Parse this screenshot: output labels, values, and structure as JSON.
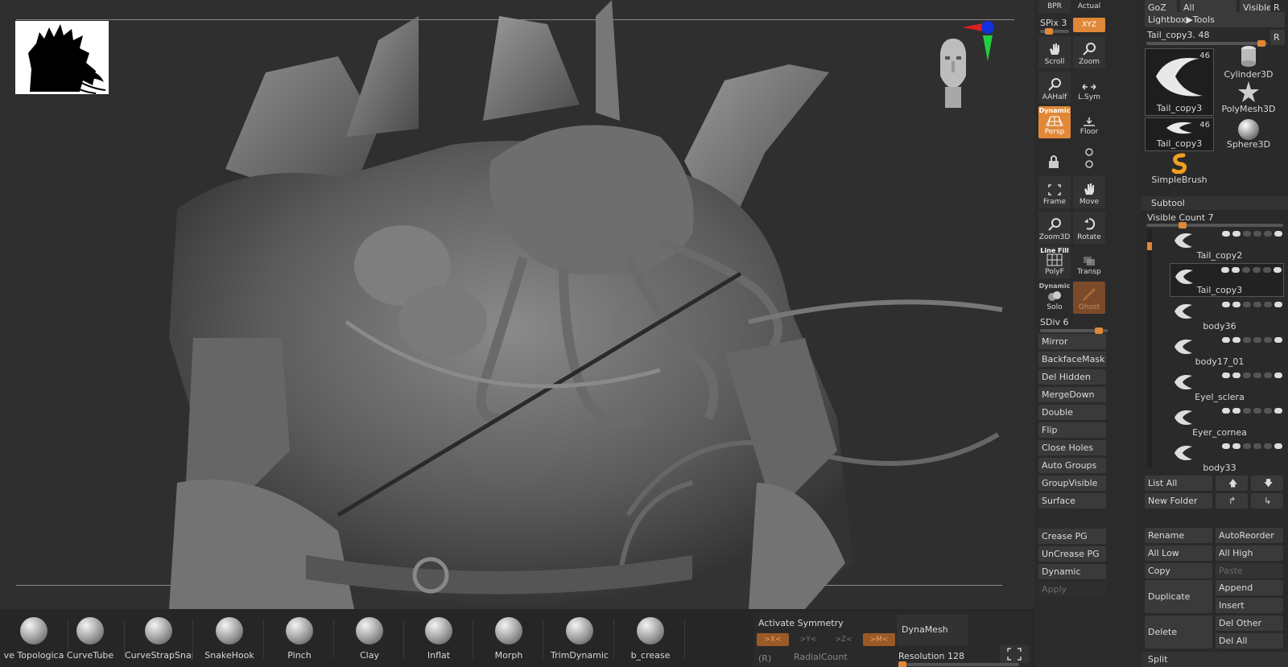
{
  "viewport": {
    "colors": {
      "background": "#2f2f2f",
      "accent": "#e08838"
    }
  },
  "shelf": {
    "bpr": "BPR",
    "actual": "Actual",
    "spix": "SPix 3",
    "xyz": "XYZ",
    "scroll": "Scroll",
    "zoom": "Zoom",
    "aahalf": "AAHalf",
    "lsym": "L.Sym",
    "persp_cap": "Dynamic",
    "persp": "Persp",
    "floor": "Floor",
    "frame": "Frame",
    "move": "Move",
    "zoom3d": "Zoom3D",
    "rotate": "Rotate",
    "polyf_cap": "Line Fill",
    "polyf": "PolyF",
    "transp": "Transp",
    "solo_cap": "Dynamic",
    "solo": "Solo",
    "ghost": "Ghost",
    "sdiv": "SDiv 6",
    "sdiv_level": 0.92
  },
  "geometry_buttons": [
    "Mirror",
    "BackfaceMask",
    "Del Hidden",
    "MergeDown",
    "Double",
    "Flip",
    "Close Holes",
    "Auto Groups",
    "GroupVisible",
    "Surface"
  ],
  "crease_buttons": [
    "Crease PG",
    "UnCrease PG",
    "Dynamic"
  ],
  "apply_button": "Apply",
  "tool": {
    "goz": "GoZ",
    "all": "All",
    "visible": "Visible",
    "r": "R",
    "lightbox": "Lightbox▶Tools",
    "current": "Tail_copy3. 48",
    "r2": "R",
    "items": [
      {
        "name": "Tail_copy3",
        "count": "46"
      },
      {
        "name": "Cylinder3D",
        "count": ""
      },
      {
        "name": "PolyMesh3D",
        "count": ""
      },
      {
        "name": "Tail_copy3",
        "count": "46"
      },
      {
        "name": "Sphere3D",
        "count": ""
      },
      {
        "name": "SimpleBrush",
        "count": ""
      }
    ]
  },
  "subtool": {
    "title": "Subtool",
    "visible_count": "Visible Count 7",
    "items": [
      "Tail_copy2",
      "Tail_copy3",
      "body36",
      "body17_01",
      "Eyel_sclera",
      "Eyer_cornea",
      "body33"
    ],
    "list_all": "List All",
    "new_folder": "New Folder",
    "rename": "Rename",
    "autoreorder": "AutoReorder",
    "all_low": "All Low",
    "all_high": "All High",
    "copy": "Copy",
    "paste": "Paste",
    "duplicate": "Duplicate",
    "append": "Append",
    "insert": "Insert",
    "delete": "Delete",
    "del_other": "Del Other",
    "del_all": "Del All",
    "split": "Split"
  },
  "brushes": [
    "ve Topologica",
    "CurveTube",
    "CurveStrapSnap",
    "SnakeHook",
    "Pinch",
    "Clay",
    "Inflat",
    "Morph",
    "TrimDynamic",
    "b_crease"
  ],
  "symmetry": {
    "activate": "Activate Symmetry",
    "x": ">X<",
    "y": ">Y<",
    "z": ">Z<",
    "m": ">M<",
    "r": "(R)",
    "radial": "RadialCount",
    "dynamesh": "DynaMesh",
    "resolution": "Resolution 128"
  }
}
